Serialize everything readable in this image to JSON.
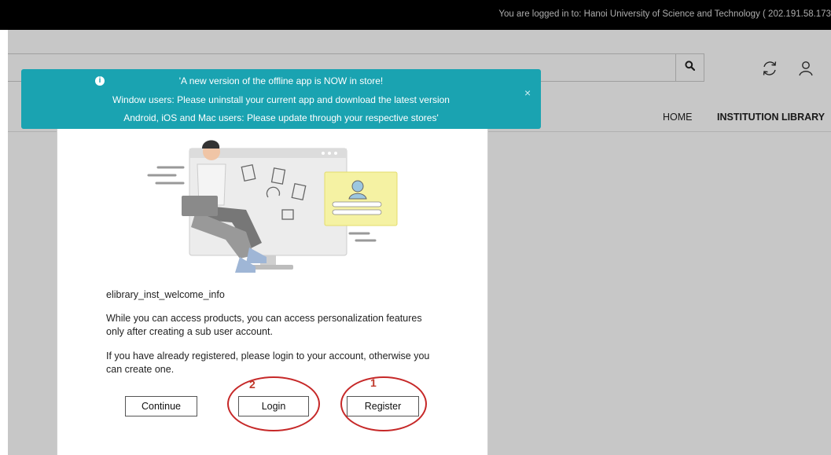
{
  "topbar": {
    "login_info": "You are logged in to: Hanoi University of Science and Technology ( 202.191.58.173"
  },
  "search": {
    "value": "",
    "placeholder": ""
  },
  "nav": {
    "home": "HOME",
    "institution_library": "INSTITUTION LIBRARY"
  },
  "banner": {
    "line1": "'A new version of the offline app is NOW in store!",
    "line2": "Window users: Please uninstall your current app and download the latest version",
    "line3": "Android, iOS and Mac users: Please update through your respective stores'",
    "close_symbol": "×",
    "info_symbol": "i",
    "color": "#1aa3b1"
  },
  "modal": {
    "title_key": "elibrary_inst_welcome_info",
    "info_text": "While you can access products, you can access personalization features only after creating a sub user account.",
    "register_text": "If you have already registered, please login to your account, otherwise you can create one.",
    "buttons": {
      "continue": "Continue",
      "login": "Login",
      "register": "Register"
    }
  },
  "annotations": {
    "login_number": "2",
    "register_number": "1",
    "color": "#c62828"
  },
  "icons": {
    "search": "search-icon",
    "sync": "sync-icon",
    "user": "user-icon",
    "info": "info-icon",
    "close": "close-icon"
  }
}
